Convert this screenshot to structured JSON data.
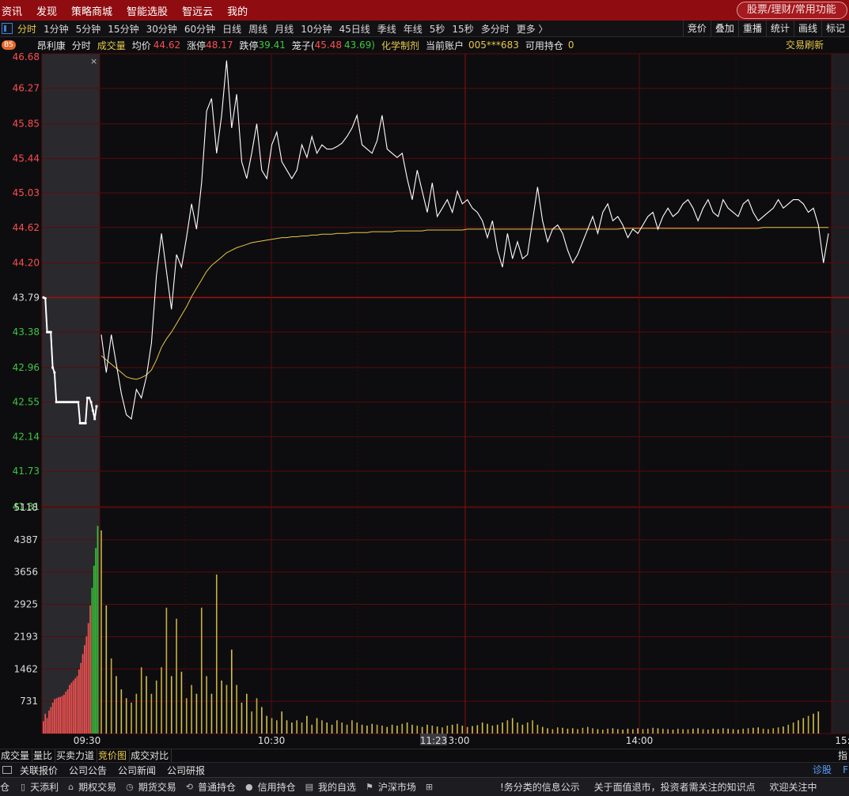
{
  "menu": [
    "资讯",
    "发现",
    "策略商城",
    "智能选股",
    "智远云",
    "我的"
  ],
  "search_placeholder": "股票/理财/常用功能",
  "periods": [
    "分时",
    "1分钟",
    "5分钟",
    "15分钟",
    "30分钟",
    "60分钟",
    "日线",
    "周线",
    "月线",
    "10分钟",
    "45日线",
    "季线",
    "年线",
    "5秒",
    "15秒",
    "多分时",
    "更多 〉"
  ],
  "active_period": 0,
  "right_tools": [
    "竞价",
    "叠加",
    "重播",
    "统计",
    "画线",
    "标记"
  ],
  "info": {
    "badge": "BS",
    "stock_name": "昂利康",
    "mode": "分时",
    "volume_label": "成交量",
    "avg_label": "均价",
    "avg_value": "44.62",
    "limit_up_label": "涨停",
    "limit_up_value": "48.17",
    "limit_down_label": "跌停",
    "limit_down_value": "39.41",
    "tweezers_label": "笼子(",
    "tweezers_high": "45.48",
    "tweezers_low": "43.69)",
    "sector": "化学制剂",
    "account_label": "当前账户",
    "account_value": "005***683",
    "position_label": "可用持仓",
    "position_value": "0",
    "refresh": "交易刷新"
  },
  "chart_data": {
    "type": "line",
    "price_ticks": [
      "46.68",
      "46.27",
      "45.85",
      "45.44",
      "45.03",
      "44.62",
      "44.20",
      "43.79",
      "43.38",
      "42.96",
      "42.55",
      "42.14",
      "41.73",
      "41.31"
    ],
    "prev_close": 43.79,
    "ylim": [
      41.31,
      46.68
    ],
    "volume_ticks": [
      "5118",
      "4387",
      "3656",
      "2925",
      "2193",
      "1462",
      "731"
    ],
    "volume_ylim": [
      0,
      5118
    ],
    "x_labels": [
      "09:30",
      "10:30",
      "11:23",
      "3:00",
      "14:00",
      "15:"
    ],
    "auction_price": [
      43.79,
      43.78,
      43.38,
      43.38,
      43.38,
      42.96,
      42.9,
      42.55,
      42.55,
      42.55,
      42.55,
      42.55,
      42.55,
      42.55,
      42.55,
      42.55,
      42.55,
      42.55,
      42.55,
      42.55,
      42.3,
      42.3,
      42.3,
      42.3,
      42.6,
      42.6,
      42.55,
      42.45,
      42.35,
      42.5
    ],
    "price": [
      43.35,
      42.9,
      43.35,
      43.0,
      42.65,
      42.4,
      42.35,
      42.7,
      42.6,
      42.85,
      43.25,
      44.05,
      44.55,
      44.1,
      43.65,
      44.3,
      44.15,
      44.5,
      44.9,
      44.6,
      45.15,
      46.0,
      46.15,
      45.5,
      45.95,
      46.6,
      45.8,
      46.2,
      45.4,
      45.2,
      45.5,
      45.85,
      45.3,
      45.2,
      45.6,
      45.75,
      45.4,
      45.3,
      45.2,
      45.3,
      45.6,
      45.45,
      45.7,
      45.5,
      45.6,
      45.55,
      45.55,
      45.58,
      45.62,
      45.7,
      45.8,
      45.95,
      45.6,
      45.55,
      45.5,
      45.65,
      45.95,
      45.55,
      45.5,
      45.45,
      45.5,
      45.2,
      44.95,
      45.3,
      45.05,
      44.8,
      45.15,
      44.75,
      44.85,
      44.95,
      44.8,
      45.05,
      44.9,
      44.95,
      44.85,
      44.8,
      44.7,
      44.5,
      44.7,
      44.35,
      44.15,
      44.55,
      44.25,
      44.45,
      44.25,
      44.3,
      44.7,
      45.1,
      44.7,
      44.45,
      44.6,
      44.65,
      44.55,
      44.35,
      44.2,
      44.3,
      44.45,
      44.6,
      44.75,
      44.55,
      44.8,
      44.9,
      44.7,
      44.75,
      44.65,
      44.5,
      44.6,
      44.55,
      44.65,
      44.75,
      44.8,
      44.6,
      44.75,
      44.85,
      44.75,
      44.8,
      44.9,
      44.95,
      44.85,
      44.7,
      44.85,
      44.95,
      44.8,
      44.75,
      44.95,
      44.85,
      44.8,
      44.75,
      44.9,
      44.95,
      44.8,
      44.7,
      44.75,
      44.8,
      44.85,
      44.95,
      44.85,
      44.9,
      44.95,
      44.95,
      44.9,
      44.8,
      44.85,
      44.65,
      44.2,
      44.55
    ],
    "avg_price": [
      43.1,
      43.05,
      43.0,
      42.95,
      42.9,
      42.85,
      42.83,
      42.82,
      42.84,
      42.87,
      42.93,
      43.05,
      43.2,
      43.3,
      43.38,
      43.48,
      43.58,
      43.68,
      43.8,
      43.9,
      44.0,
      44.1,
      44.17,
      44.22,
      44.27,
      44.32,
      44.35,
      44.38,
      44.4,
      44.42,
      44.44,
      44.45,
      44.46,
      44.47,
      44.48,
      44.49,
      44.5,
      44.5,
      44.51,
      44.51,
      44.52,
      44.52,
      44.53,
      44.53,
      44.54,
      44.54,
      44.54,
      44.55,
      44.55,
      44.55,
      44.56,
      44.56,
      44.56,
      44.56,
      44.57,
      44.57,
      44.57,
      44.57,
      44.57,
      44.58,
      44.58,
      44.58,
      44.58,
      44.58,
      44.58,
      44.59,
      44.59,
      44.59,
      44.59,
      44.59,
      44.59,
      44.59,
      44.59,
      44.6,
      44.6,
      44.6,
      44.6,
      44.6,
      44.6,
      44.6,
      44.6,
      44.6,
      44.6,
      44.6,
      44.6,
      44.6,
      44.6,
      44.6,
      44.6,
      44.6,
      44.6,
      44.6,
      44.6,
      44.6,
      44.6,
      44.6,
      44.6,
      44.6,
      44.6,
      44.6,
      44.6,
      44.6,
      44.6,
      44.6,
      44.61,
      44.61,
      44.61,
      44.61,
      44.61,
      44.61,
      44.61,
      44.61,
      44.61,
      44.61,
      44.61,
      44.61,
      44.61,
      44.61,
      44.61,
      44.61,
      44.61,
      44.61,
      44.61,
      44.61,
      44.61,
      44.61,
      44.61,
      44.61,
      44.61,
      44.61,
      44.61,
      44.61,
      44.62,
      44.62,
      44.62,
      44.62,
      44.62,
      44.62,
      44.62,
      44.62,
      44.62,
      44.62,
      44.62,
      44.62,
      44.62,
      44.62
    ],
    "auction_volume": [
      280,
      450,
      350,
      520,
      600,
      700,
      780,
      800,
      820,
      830,
      850,
      880,
      950,
      1000,
      1100,
      1150,
      1200,
      1250,
      1300,
      1450,
      1600,
      1800,
      2000,
      2200,
      2500,
      2900,
      3300,
      3800,
      4200,
      4700
    ],
    "volume": [
      4600,
      2900,
      1700,
      1300,
      1000,
      800,
      700,
      900,
      1500,
      1300,
      900,
      1200,
      1500,
      2850,
      1300,
      2600,
      1400,
      800,
      1100,
      900,
      2850,
      1300,
      900,
      3600,
      1200,
      1100,
      1900,
      1100,
      700,
      900,
      500,
      800,
      600,
      400,
      350,
      300,
      500,
      300,
      250,
      300,
      250,
      400,
      200,
      350,
      300,
      250,
      200,
      300,
      250,
      200,
      300,
      250,
      200,
      180,
      220,
      200,
      180,
      150,
      200,
      180,
      220,
      250,
      200,
      180,
      150,
      200,
      180,
      160,
      140,
      180,
      200,
      220,
      180,
      150,
      170,
      190,
      250,
      220,
      180,
      200,
      250,
      300,
      350,
      250,
      200,
      250,
      300,
      200,
      150,
      120,
      100,
      140,
      130,
      110,
      120,
      100,
      130,
      150,
      120,
      100,
      90,
      110,
      120,
      100,
      90,
      110,
      100,
      120,
      100,
      110,
      130,
      120,
      110,
      100,
      90,
      110,
      100,
      95,
      110,
      120,
      100,
      90,
      110,
      100,
      120,
      110,
      100,
      90,
      110,
      120,
      130,
      140,
      110,
      100,
      120,
      140,
      160,
      200,
      250,
      300,
      350,
      400,
      450,
      500
    ],
    "volume_up": [
      true,
      false,
      true,
      false,
      false,
      false,
      true,
      true,
      true,
      false,
      true,
      true,
      true,
      true,
      false,
      true,
      false,
      true,
      true,
      false,
      true,
      true,
      false,
      true,
      false,
      true,
      false,
      true,
      false,
      false,
      true,
      true,
      false,
      false,
      true,
      true,
      false,
      false,
      false,
      true,
      true,
      false,
      true,
      false,
      true,
      false,
      false,
      true,
      true,
      true,
      true,
      true,
      false,
      false,
      false,
      true,
      true,
      false,
      false,
      false,
      true,
      false,
      false,
      true,
      false,
      false,
      true,
      false,
      true,
      true,
      false,
      true,
      false,
      true,
      false,
      false,
      false,
      false,
      true,
      false,
      false,
      true,
      false,
      true,
      false,
      true,
      true,
      true,
      false,
      false,
      true,
      true,
      false,
      false,
      false,
      true,
      true,
      true,
      true,
      false,
      true,
      true,
      false,
      true,
      false,
      false,
      true,
      false,
      true,
      true,
      true,
      false,
      true,
      true,
      false,
      true,
      true,
      true,
      false,
      false,
      true,
      true,
      false,
      false,
      true,
      false,
      false,
      false,
      true,
      true,
      false,
      false,
      true,
      true,
      true,
      true,
      false,
      true,
      true,
      false,
      false,
      true,
      false,
      false,
      true,
      true,
      false,
      true
    ]
  },
  "sub_tabs": [
    "成交量",
    "量比",
    "买卖力道",
    "竞价图",
    "成交对比"
  ],
  "active_sub_tab": 3,
  "sub_right": "指",
  "news_tabs": [
    "关联报价",
    "公司公告",
    "公司新闻",
    "公司研报"
  ],
  "diagnose": "诊股",
  "news_right": "F",
  "status_items": [
    {
      "icon": "phone-icon",
      "glyph": "▯",
      "label": "天添利"
    },
    {
      "icon": "bank-icon",
      "glyph": "⌂",
      "label": "期权交易"
    },
    {
      "icon": "clock-icon",
      "glyph": "◷",
      "label": "期货交易"
    },
    {
      "icon": "cycle-icon",
      "glyph": "⟲",
      "label": "普通持仓"
    },
    {
      "icon": "credit-icon",
      "glyph": "●",
      "label": "信用持仓"
    },
    {
      "icon": "chart-icon",
      "glyph": "▤",
      "label": "我的自选"
    },
    {
      "icon": "bookmark-icon",
      "glyph": "⚑",
      "label": "沪深市场"
    },
    {
      "icon": "plus-icon",
      "glyph": "⊞",
      "label": ""
    }
  ],
  "status_left": "仓",
  "ticker": [
    "!务分类的信息公示",
    "关于面值退市，投资者需关注的知识点",
    "欢迎关注中"
  ]
}
